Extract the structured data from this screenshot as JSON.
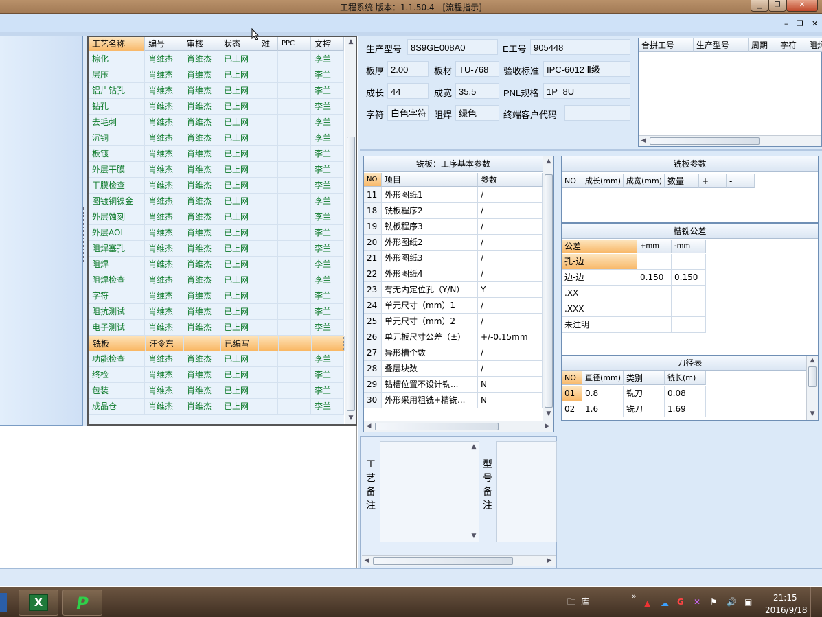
{
  "window": {
    "title": "工程系统   版本：1.1.50.4 - [流程指示]",
    "min": "▁",
    "max": "❐",
    "close": "✕"
  },
  "mdi": {
    "min": "–",
    "restore": "❐",
    "close": "✕"
  },
  "process_grid": {
    "headers": [
      "工艺名称",
      "编号",
      "审核",
      "状态",
      "难",
      "PPC",
      "文控"
    ],
    "rows": [
      [
        "棕化",
        "肖维杰",
        "肖维杰",
        "已上网",
        "",
        "",
        "李兰"
      ],
      [
        "层压",
        "肖维杰",
        "肖维杰",
        "已上网",
        "",
        "",
        "李兰"
      ],
      [
        "铝片钻孔",
        "肖维杰",
        "肖维杰",
        "已上网",
        "",
        "",
        "李兰"
      ],
      [
        "钻孔",
        "肖维杰",
        "肖维杰",
        "已上网",
        "",
        "",
        "李兰"
      ],
      [
        "去毛刺",
        "肖维杰",
        "肖维杰",
        "已上网",
        "",
        "",
        "李兰"
      ],
      [
        "沉铜",
        "肖维杰",
        "肖维杰",
        "已上网",
        "",
        "",
        "李兰"
      ],
      [
        "板镀",
        "肖维杰",
        "肖维杰",
        "已上网",
        "",
        "",
        "李兰"
      ],
      [
        "外层干膜",
        "肖维杰",
        "肖维杰",
        "已上网",
        "",
        "",
        "李兰"
      ],
      [
        "干膜检查",
        "肖维杰",
        "肖维杰",
        "已上网",
        "",
        "",
        "李兰"
      ],
      [
        "图镀铜镍金",
        "肖维杰",
        "肖维杰",
        "已上网",
        "",
        "",
        "李兰"
      ],
      [
        "外层蚀刻",
        "肖维杰",
        "肖维杰",
        "已上网",
        "",
        "",
        "李兰"
      ],
      [
        "外层AOI",
        "肖维杰",
        "肖维杰",
        "已上网",
        "",
        "",
        "李兰"
      ],
      [
        "阻焊塞孔",
        "肖维杰",
        "肖维杰",
        "已上网",
        "",
        "",
        "李兰"
      ],
      [
        "阻焊",
        "肖维杰",
        "肖维杰",
        "已上网",
        "",
        "",
        "李兰"
      ],
      [
        "阻焊检查",
        "肖维杰",
        "肖维杰",
        "已上网",
        "",
        "",
        "李兰"
      ],
      [
        "字符",
        "肖维杰",
        "肖维杰",
        "已上网",
        "",
        "",
        "李兰"
      ],
      [
        "阻抗测试",
        "肖维杰",
        "肖维杰",
        "已上网",
        "",
        "",
        "李兰"
      ],
      [
        "电子测试",
        "肖维杰",
        "肖维杰",
        "已上网",
        "",
        "",
        "李兰"
      ],
      [
        "铣板",
        "汪令东",
        "",
        "已编写",
        "",
        "",
        ""
      ],
      [
        "功能检查",
        "肖维杰",
        "肖维杰",
        "已上网",
        "",
        "",
        "李兰"
      ],
      [
        "终检",
        "肖维杰",
        "肖维杰",
        "已上网",
        "",
        "",
        "李兰"
      ],
      [
        "包装",
        "肖维杰",
        "肖维杰",
        "已上网",
        "",
        "",
        "李兰"
      ],
      [
        "成品仓",
        "肖维杰",
        "肖维杰",
        "已上网",
        "",
        "",
        "李兰"
      ]
    ],
    "selected_index": 18
  },
  "info": {
    "prod_model_label": "生产型号",
    "prod_model": "8S9GE008A0",
    "e_no_label": "E工号",
    "e_no": "905448",
    "thickness_label": "板厚",
    "thickness": "2.00",
    "material_label": "板材",
    "material": "TU-768",
    "standard_label": "验收标准",
    "standard": "IPC-6012 Ⅱ级",
    "length_label": "成长",
    "length": "44",
    "width_label": "成宽",
    "width": "35.5",
    "pnl_label": "PNL规格",
    "pnl": "1P=8U",
    "char_label": "字符",
    "char": "白色字符",
    "mask_label": "阻焊",
    "mask": "绿色",
    "customer_label": "终端客户代码",
    "customer": ""
  },
  "merge_table": {
    "headers": [
      "合拼工号",
      "生产型号",
      "周期",
      "字符",
      "阻焊"
    ]
  },
  "basic_params": {
    "title": "铣板：工序基本参数",
    "headers": [
      "NO",
      "项目",
      "参数"
    ],
    "rows": [
      [
        "11",
        "外形图纸1",
        "/"
      ],
      [
        "18",
        "铣板程序2",
        "/"
      ],
      [
        "19",
        "铣板程序3",
        "/"
      ],
      [
        "20",
        "外形图纸2",
        "/"
      ],
      [
        "21",
        "外形图纸3",
        "/"
      ],
      [
        "22",
        "外形图纸4",
        "/"
      ],
      [
        "23",
        "有无内定位孔（Y/N）",
        "Y"
      ],
      [
        "24",
        "单元尺寸（mm）1",
        "/"
      ],
      [
        "25",
        "单元尺寸（mm）2",
        "/"
      ],
      [
        "26",
        "单元板尺寸公差（±）",
        "+/-0.15mm"
      ],
      [
        "27",
        "异形槽个数",
        "/"
      ],
      [
        "28",
        "叠层块数",
        "/"
      ],
      [
        "29",
        "钻槽位置不设计铣...",
        "N"
      ],
      [
        "30",
        "外形采用粗铣+精铣...",
        "N"
      ]
    ]
  },
  "mill_params": {
    "title": "铣板参数",
    "headers": [
      "NO",
      "成长(mm)",
      "成宽(mm)",
      "数量",
      "+",
      "-"
    ]
  },
  "slot_tolerance": {
    "title": "槽铣公差",
    "headers": [
      "公差",
      "+mm",
      "-mm"
    ],
    "rows": [
      [
        "孔-边",
        "",
        ""
      ],
      [
        "边-边",
        "0.150",
        "0.150"
      ],
      [
        ".XX",
        "",
        ""
      ],
      [
        ".XXX",
        "",
        ""
      ],
      [
        "未注明",
        "",
        ""
      ]
    ]
  },
  "tool_table": {
    "title": "刀径表",
    "headers": [
      "NO",
      "直径(mm)",
      "类别",
      "铣长(m)"
    ],
    "rows": [
      [
        "01",
        "0.8",
        "铣刀",
        "0.08"
      ],
      [
        "02",
        "1.6",
        "铣刀",
        "1.69"
      ]
    ]
  },
  "remarks": {
    "process_label": "工艺备注",
    "model_label": "型号备注"
  },
  "taskbar": {
    "library": "库",
    "more": "»",
    "time": "21:15",
    "date": "2016/9/18"
  }
}
